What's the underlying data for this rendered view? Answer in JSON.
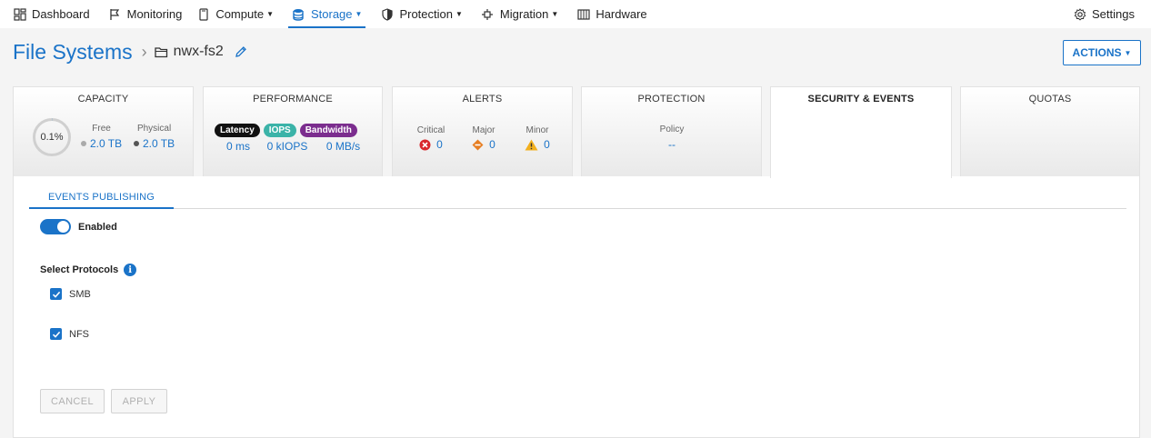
{
  "nav": {
    "dashboard": "Dashboard",
    "monitoring": "Monitoring",
    "compute": "Compute",
    "storage": "Storage",
    "protection": "Protection",
    "migration": "Migration",
    "hardware": "Hardware",
    "settings": "Settings",
    "active": "storage"
  },
  "header": {
    "title": "File Systems",
    "filesystem_name": "nwx-fs2",
    "actions_label": "ACTIONS"
  },
  "tiles": {
    "capacity": {
      "title": "CAPACITY",
      "used_percent_label": "0.1%",
      "used_fraction": 0.001,
      "free_label": "Free",
      "free_value": "2.0 TB",
      "physical_label": "Physical",
      "physical_value": "2.0 TB"
    },
    "performance": {
      "title": "PERFORMANCE",
      "latency_badge": "Latency",
      "iops_badge": "IOPS",
      "bandwidth_badge": "Bandwidth",
      "latency_value": "0 ms",
      "iops_value": "0 kIOPS",
      "bandwidth_value": "0 MB/s"
    },
    "alerts": {
      "title": "ALERTS",
      "critical_label": "Critical",
      "critical_value": "0",
      "major_label": "Major",
      "major_value": "0",
      "minor_label": "Minor",
      "minor_value": "0"
    },
    "protection": {
      "title": "PROTECTION",
      "policy_label": "Policy",
      "policy_value": "--"
    },
    "security": {
      "title": "SECURITY & EVENTS"
    },
    "quotas": {
      "title": "QUOTAS"
    }
  },
  "events": {
    "tab_label": "EVENTS PUBLISHING",
    "toggle_label": "Enabled",
    "toggle_on": true,
    "protocols_label": "Select Protocols",
    "protocols": [
      {
        "label": "SMB",
        "checked": true
      },
      {
        "label": "NFS",
        "checked": true
      }
    ],
    "cancel_label": "CANCEL",
    "apply_label": "APPLY"
  },
  "colors": {
    "accent": "#1a73c8",
    "latency_badge": "#111111",
    "iops_badge": "#3bb3a8",
    "bandwidth_badge": "#7b2d8e",
    "critical": "#d9262c",
    "major": "#e67e22",
    "minor": "#f2b01e"
  }
}
